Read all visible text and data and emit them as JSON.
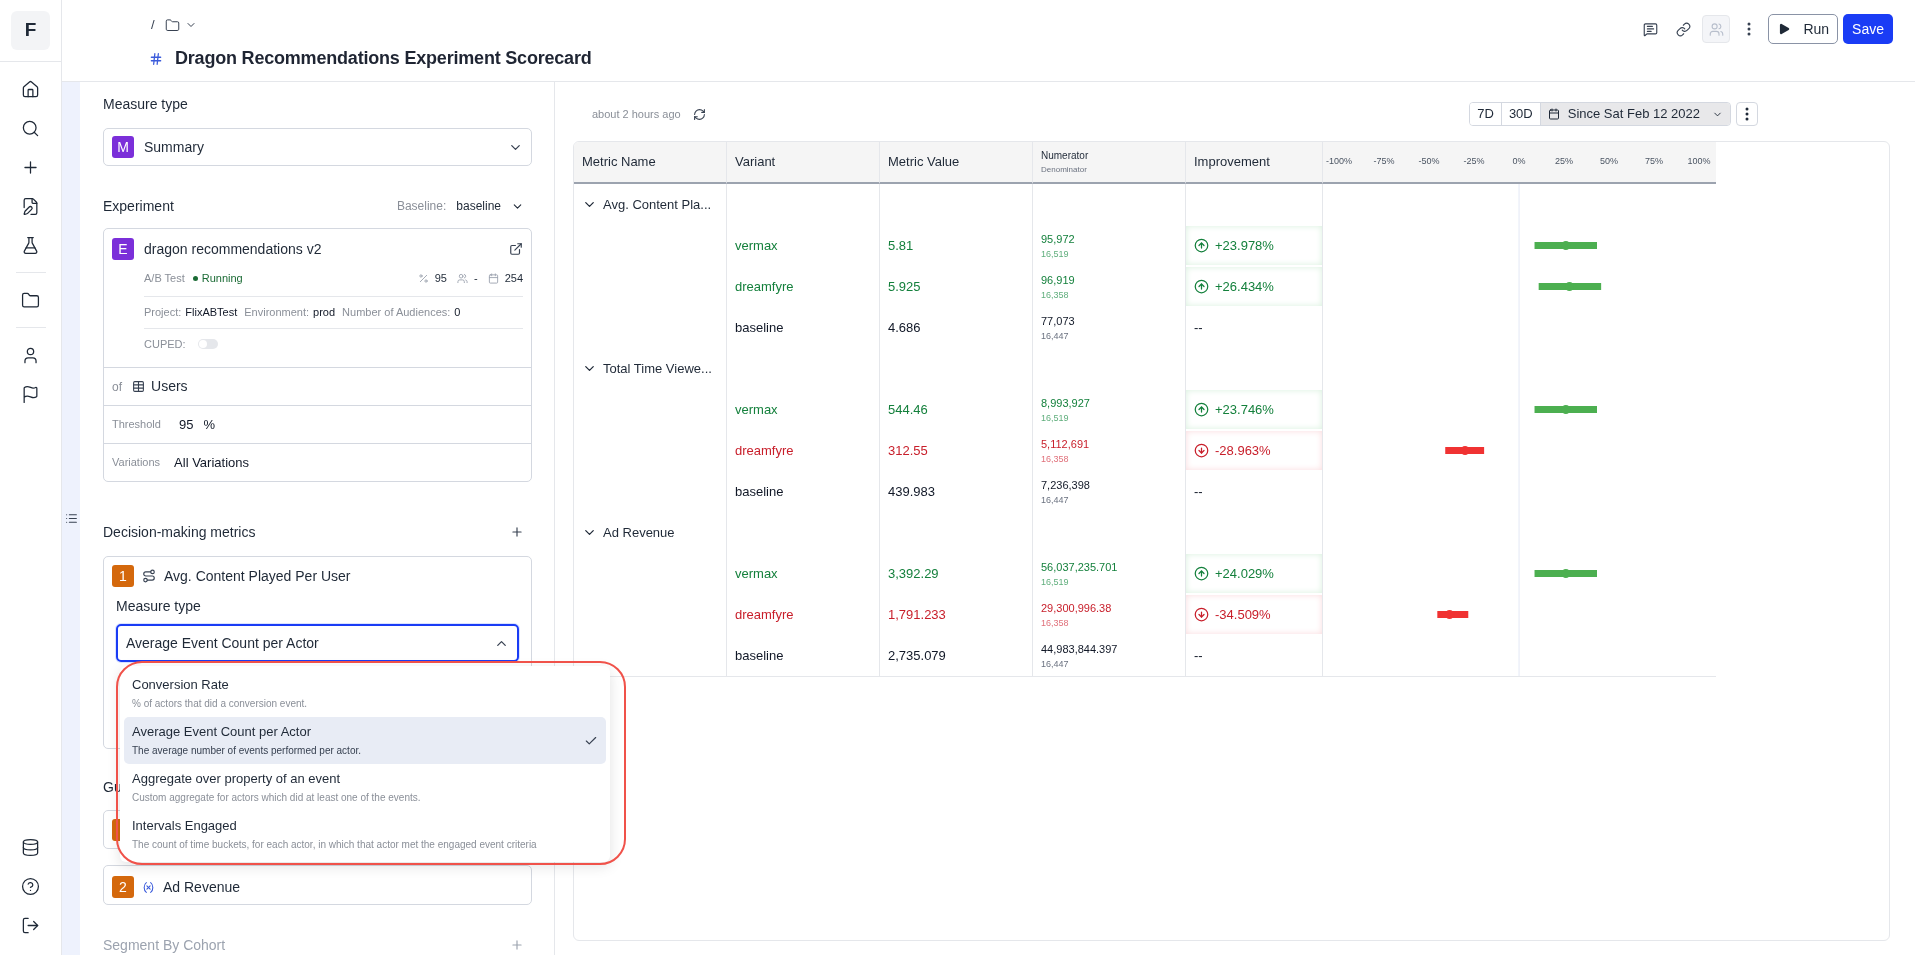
{
  "rail": {
    "logo": "F"
  },
  "breadcrumb": {
    "separator": "/"
  },
  "title": "Dragon Recommendations Experiment Scorecard",
  "header_actions": [
    {
      "kind": "comment",
      "disabled": false
    },
    {
      "kind": "link",
      "disabled": false
    },
    {
      "kind": "share",
      "disabled": true
    },
    {
      "kind": "more",
      "disabled": false
    },
    {
      "kind": "run",
      "label": "Run",
      "disabled": false
    },
    {
      "kind": "save",
      "label": "Save",
      "disabled": false
    }
  ],
  "config": {
    "measure": {
      "label": "Measure type",
      "badge": "M",
      "value": "Summary"
    },
    "experiment": {
      "heading": "Experiment",
      "baseline_label": "Baseline:",
      "baseline_value": "baseline",
      "badge": "E",
      "name": "dragon recommendations v2",
      "type": "A/B Test",
      "status": "Running",
      "confidence": "95",
      "audience": "-",
      "days": "254",
      "project_label": "Project:",
      "project": "FlixABTest",
      "environment_label": "Environment:",
      "environment": "prod",
      "audiences_label": "Number of Audiences:",
      "audiences": "0",
      "cuped_label": "CUPED:",
      "cuped_on": false,
      "of_label": "of",
      "actor": "Users",
      "threshold_label": "Threshold",
      "threshold": "95",
      "threshold_unit": "%",
      "variations_label": "Variations",
      "variations": "All Variations"
    },
    "decision": {
      "heading": "Decision-making metrics",
      "metric": {
        "badge": "1",
        "name": "Avg. Content Played Per User",
        "measure_label": "Measure type",
        "measure_value": "Average Event Count per Actor",
        "open": true
      },
      "options": [
        {
          "label": "Conversion Rate",
          "description": "% of actors that did a conversion event.",
          "selected": false
        },
        {
          "label": "Average Event Count per Actor",
          "description": "The average number of events performed per actor.",
          "selected": true
        },
        {
          "label": "Aggregate over property of an event",
          "description": "Custom aggregate for actors which did at least one of the events.",
          "selected": false
        },
        {
          "label": "Intervals Engaged",
          "description": "The count of time buckets, for each actor, in which that actor met the engaged event criteria",
          "selected": false
        }
      ]
    },
    "guardrail": {
      "heading": "Gu",
      "metrics": [
        {
          "badge": "2",
          "name": "Ad Revenue"
        }
      ]
    },
    "segment": {
      "heading": "Segment By Cohort"
    }
  },
  "results": {
    "updated": "about 2 hours ago",
    "ranges": [
      {
        "label": "7D",
        "kind": "preset",
        "selected": false
      },
      {
        "label": "30D",
        "kind": "preset",
        "selected": false
      },
      {
        "label": "Since Sat Feb 12 2022",
        "kind": "date",
        "selected": true
      }
    ],
    "columns": {
      "metric": "Metric Name",
      "variant": "Variant",
      "value": "Metric Value",
      "numerator": "Numerator",
      "denominator": "Denominator",
      "improvement": "Improvement"
    },
    "rows": [
      {
        "kind": "group",
        "name": "Avg. Content Pla...",
        "expanded": true
      },
      {
        "kind": "variant",
        "variant": "vermax",
        "positive": true,
        "value": "5.81",
        "numerator": "95,972",
        "denominator": "16,519",
        "improvement": "+23.978%"
      },
      {
        "kind": "variant",
        "variant": "dreamfyre",
        "positive": true,
        "value": "5.925",
        "numerator": "96,919",
        "denominator": "16,358",
        "improvement": "+26.434%"
      },
      {
        "kind": "baseline",
        "variant": "baseline",
        "value": "4.686",
        "numerator": "77,073",
        "denominator": "16,447",
        "improvement": "--"
      },
      {
        "kind": "group",
        "name": "Total Time Viewe...",
        "expanded": true
      },
      {
        "kind": "variant",
        "variant": "vermax",
        "positive": true,
        "value": "544.46",
        "numerator": "8,993,927",
        "denominator": "16,519",
        "improvement": "+23.746%"
      },
      {
        "kind": "variant",
        "variant": "dreamfyre",
        "positive": false,
        "value": "312.55",
        "numerator": "5,112,691",
        "denominator": "16,358",
        "improvement": "-28.963%"
      },
      {
        "kind": "baseline",
        "variant": "baseline",
        "value": "439.983",
        "numerator": "7,236,398",
        "denominator": "16,447",
        "improvement": "--"
      },
      {
        "kind": "group",
        "name": "Ad Revenue",
        "expanded": true
      },
      {
        "kind": "variant",
        "variant": "vermax",
        "positive": true,
        "value": "3,392.29",
        "numerator": "56,037,235.701",
        "denominator": "16,519",
        "improvement": "+24.029%"
      },
      {
        "kind": "variant",
        "variant": "dreamfyre",
        "positive": false,
        "value": "1,791.233",
        "numerator": "29,300,996.38",
        "denominator": "16,358",
        "improvement": "-34.509%"
      },
      {
        "kind": "baseline",
        "variant": "baseline",
        "value": "2,735.079",
        "numerator": "44,983,844.397",
        "denominator": "16,447",
        "improvement": "--"
      }
    ],
    "chart_data": {
      "type": "scatter",
      "orientation": "horizontal",
      "categories": [
        null,
        null,
        null,
        null,
        null,
        null,
        null,
        null,
        null,
        null,
        null,
        null
      ],
      "xlim": [
        -108.9,
        109.4
      ],
      "xticks": [
        {
          "value": -100,
          "label": "-100%"
        },
        {
          "value": -75,
          "label": "-75%"
        },
        {
          "value": -50,
          "label": "-50%"
        },
        {
          "value": -25,
          "label": "-25%"
        },
        {
          "value": 0,
          "label": "0%"
        },
        {
          "value": 25,
          "label": "25%"
        },
        {
          "value": 50,
          "label": "50%"
        },
        {
          "value": 75,
          "label": "75%"
        },
        {
          "value": 100,
          "label": "100%"
        }
      ],
      "series": [
        {
          "color": "#4caf50",
          "values": [
            null,
            26,
            28,
            null,
            null,
            26,
            null,
            null,
            null,
            26,
            null,
            null
          ],
          "errors": [
            null,
            [
              8.6,
              43.3
            ],
            [
              10.9,
              45.6
            ],
            null,
            null,
            [
              8.6,
              43.3
            ],
            null,
            null,
            null,
            [
              8.6,
              43.3
            ],
            null,
            null
          ]
        },
        {
          "color": "#f03232",
          "values": [
            null,
            null,
            null,
            null,
            null,
            null,
            -30,
            null,
            null,
            null,
            -38.6,
            null
          ],
          "errors": [
            null,
            null,
            null,
            null,
            null,
            null,
            [
              -41,
              -19.4
            ],
            null,
            null,
            null,
            [
              -45.4,
              -28.2
            ],
            null
          ]
        }
      ]
    }
  }
}
